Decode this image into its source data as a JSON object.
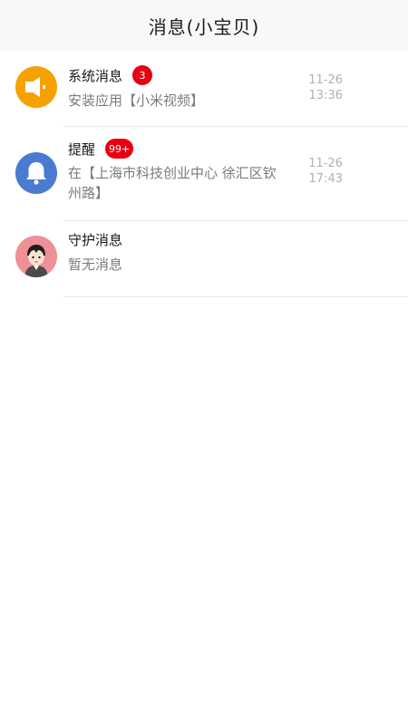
{
  "header": {
    "title": "消息(小宝贝)"
  },
  "messages": [
    {
      "title": "系统消息",
      "badge": "3",
      "subtitle": "安装应用【小米视频】",
      "date": "11-26",
      "time": "13:36",
      "icon": "speaker-icon",
      "icon_bg": "#f5a200"
    },
    {
      "title": "提醒",
      "badge": "99+",
      "subtitle": "在【上海市科技创业中心 徐汇区钦州路】",
      "date": "11-26",
      "time": "17:43",
      "icon": "bell-icon",
      "icon_bg": "#4a7bd0"
    },
    {
      "title": "守护消息",
      "subtitle": "暂无消息",
      "icon": "child-avatar",
      "icon_bg": "#ef8f96"
    }
  ],
  "colors": {
    "badge": "#e60012",
    "header_bg": "#f8f8fa"
  }
}
